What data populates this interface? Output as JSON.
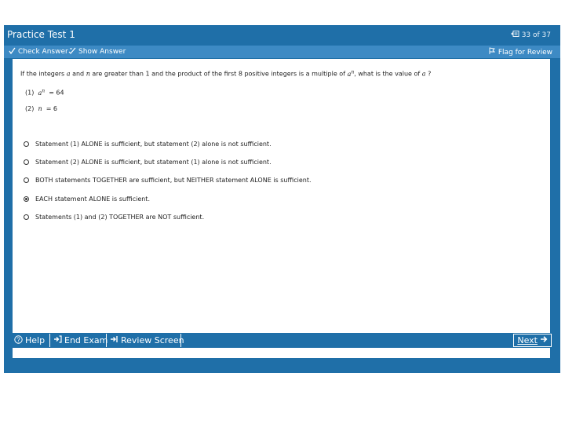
{
  "window": {
    "title": "Practice Test 1",
    "counter": "33 of 37"
  },
  "toolbar": {
    "check_answer": "Check Answer",
    "show_answer": "Show Answer",
    "flag_for_review": "Flag for Review"
  },
  "question": {
    "text_1": "If the integers",
    "var_a": "a",
    "text_2": "and",
    "var_n": "n",
    "text_3": "are greater than 1 and the product of the first 8 positive integers is a multiple of",
    "text_4": ", what is the value of",
    "text_5": "?",
    "stmt1_label": "(1)",
    "stmt1_eq": "= 64",
    "stmt2_label": "(2)",
    "stmt2_eq": "= 6"
  },
  "options": [
    {
      "label": "Statement (1) ALONE is sufficient, but statement (2) alone is not sufficient.",
      "selected": false
    },
    {
      "label": "Statement (2) ALONE is sufficient, but statement (1) alone is not sufficient.",
      "selected": false
    },
    {
      "label": "BOTH statements TOGETHER are sufficient, but NEITHER statement ALONE is sufficient.",
      "selected": false
    },
    {
      "label": "EACH statement ALONE is sufficient.",
      "selected": true
    },
    {
      "label": "Statements (1) and (2) TOGETHER are NOT sufficient.",
      "selected": false
    }
  ],
  "bottombar": {
    "help": "Help",
    "end_exam": "End Exam",
    "review_screen": "Review Screen",
    "next": "Next"
  },
  "colors": {
    "frame": "#1f6fa8",
    "toolbar": "#3d8ac4",
    "content": "#ffffff"
  }
}
